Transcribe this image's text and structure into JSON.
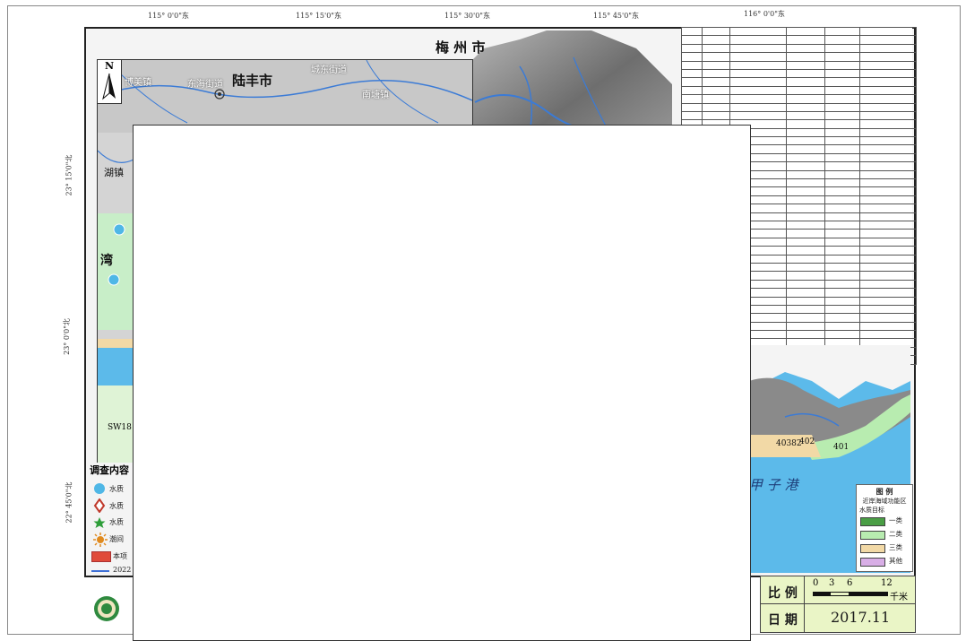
{
  "map": {
    "title_city": "梅 州 市",
    "inset_city": "陆丰市",
    "north_label": "N",
    "bay_label": "甲 子 港",
    "top_coords": [
      "115° 0'0\"东",
      "115° 15'0\"东",
      "115° 30'0\"东",
      "115° 45'0\"东",
      "116° 0'0\"东"
    ],
    "left_coords": [
      "23° 15'0\"北",
      "23° 0'0\"北",
      "22° 45'0\"北"
    ],
    "inset_labels": [
      "城东街道",
      "东海街道",
      "博美镇",
      "南塘镇",
      "陆丰市"
    ],
    "side_labels": [
      "湖镇",
      "湾",
      "SW18"
    ],
    "zone_labels": [
      "40382",
      "402",
      "401"
    ]
  },
  "legend": {
    "title": "图 例",
    "subtitle1": "近岸海域功能区",
    "subtitle2": "水质目标",
    "items": [
      {
        "label": "一类",
        "color": "#4a9e45"
      },
      {
        "label": "二类",
        "color": "#b8ecb0"
      },
      {
        "label": "三类",
        "color": "#f2d9a6"
      },
      {
        "label": "其他",
        "color": "#d8aee6"
      }
    ]
  },
  "survey_legend": {
    "title": "调查内容",
    "items": [
      {
        "label": "水质",
        "icon": "circle-icon",
        "color": "#4fb7e6"
      },
      {
        "label": "水质",
        "icon": "diamond-icon",
        "color": "#c0392b"
      },
      {
        "label": "水质",
        "icon": "star-icon",
        "color": "#2e9e3a"
      },
      {
        "label": "潮间",
        "icon": "sun-icon",
        "color": "#e08a1e"
      },
      {
        "label": "本项",
        "icon": "rect-icon",
        "color": "#e04a3a"
      },
      {
        "label": "2022",
        "icon": "line-icon",
        "color": "#3d6fd6"
      }
    ]
  },
  "scale": {
    "label": "比 例",
    "ticks": [
      "0",
      "3",
      "6",
      "12"
    ],
    "unit": "千米",
    "date_label": "日 期",
    "date_value": "2017.11"
  }
}
